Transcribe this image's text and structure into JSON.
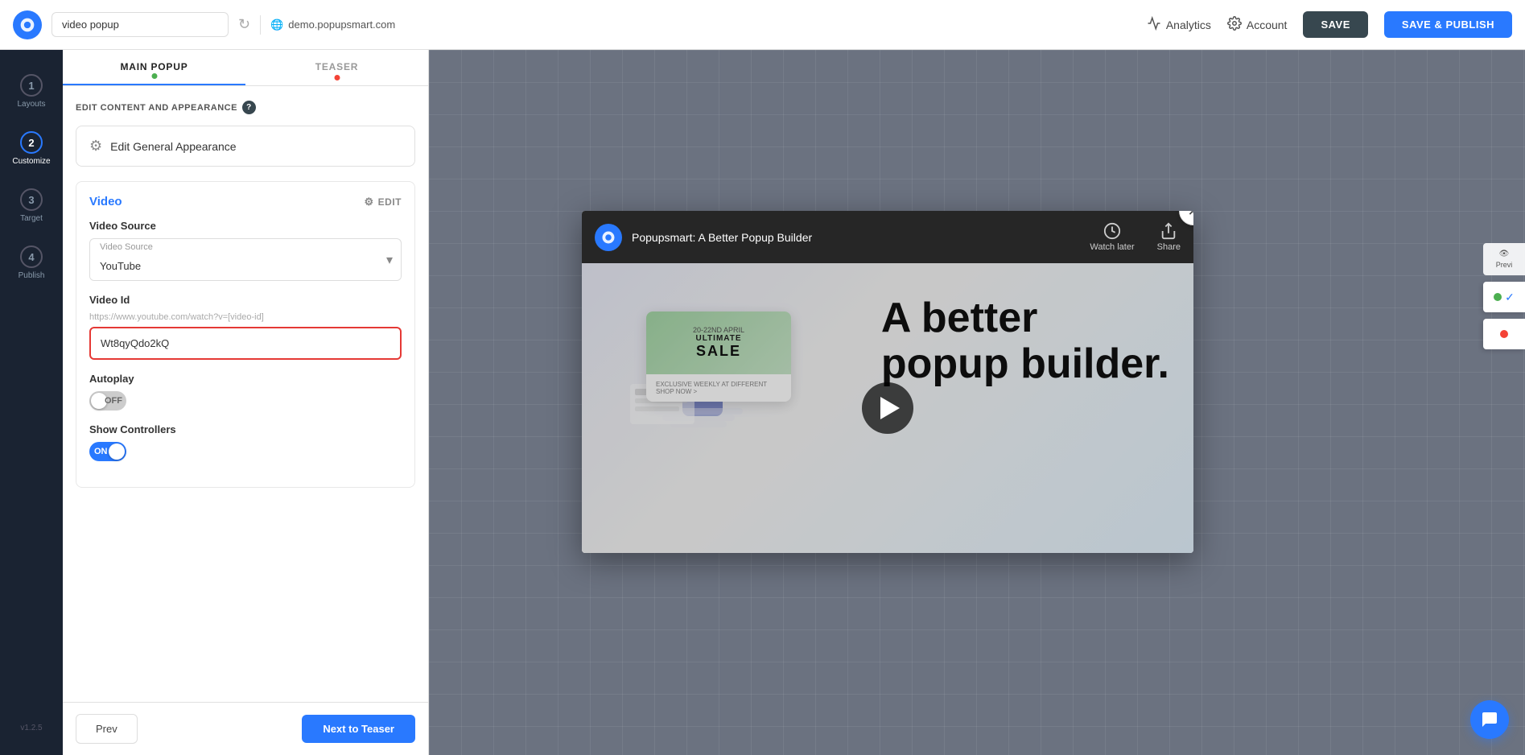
{
  "topbar": {
    "logo_alt": "Popupsmart logo",
    "search_value": "video popup",
    "url": "demo.popupsmart.com",
    "analytics_label": "Analytics",
    "account_label": "Account",
    "save_label": "SAVE",
    "save_publish_label": "SAVE & PUBLISH"
  },
  "nav": {
    "items": [
      {
        "number": "1",
        "label": "Layouts"
      },
      {
        "number": "2",
        "label": "Customize",
        "active": true
      },
      {
        "number": "3",
        "label": "Target"
      },
      {
        "number": "4",
        "label": "Publish"
      }
    ],
    "version": "v1.2.5"
  },
  "tabs": {
    "main_popup": "MAIN POPUP",
    "teaser": "TEASER"
  },
  "panel": {
    "section_title": "EDIT CONTENT AND APPEARANCE",
    "edit_general_btn": "Edit General Appearance",
    "video_section_title": "Video",
    "edit_link": "EDIT",
    "video_source_label": "Video Source",
    "video_source_select_label": "Video Source",
    "video_source_option": "YouTube",
    "video_id_label": "Video Id",
    "video_id_hint": "https://www.youtube.com/watch?v=[video-id]",
    "video_id_value": "Wt8qyQdo2kQ",
    "autoplay_label": "Autoplay",
    "autoplay_state": "OFF",
    "show_controllers_label": "Show Controllers",
    "show_controllers_state": "ON"
  },
  "footer": {
    "prev_label": "Prev",
    "next_label": "Next to Teaser"
  },
  "popup_preview": {
    "channel_name": "Popupsmart: A Better Popup Builder",
    "watch_later": "Watch later",
    "share": "Share",
    "big_text_line1": "A better",
    "big_text_line2": "popup builder.",
    "sale_date": "20-22ND APRIL",
    "sale_title": "ULTIMATE",
    "sale_text": "SALE",
    "sale_body": "EXCLUSIVE WEEKLY AT DIFFERENT SHOP NOW >"
  },
  "icons": {
    "close": "✕",
    "settings": "⚙",
    "analytics_icon": "analytics-icon",
    "gear_icon": "gear-icon",
    "globe_icon": "globe-icon",
    "clock_icon": "clock-icon",
    "share_icon": "share-icon",
    "eye_icon": "eye-icon",
    "chat_icon": "chat-icon"
  },
  "colors": {
    "primary": "#2979ff",
    "dark_nav": "#1a2332",
    "active_tab": "#2979ff",
    "toggle_on": "#2979ff",
    "toggle_off": "#ccc",
    "input_error": "#e53935"
  }
}
